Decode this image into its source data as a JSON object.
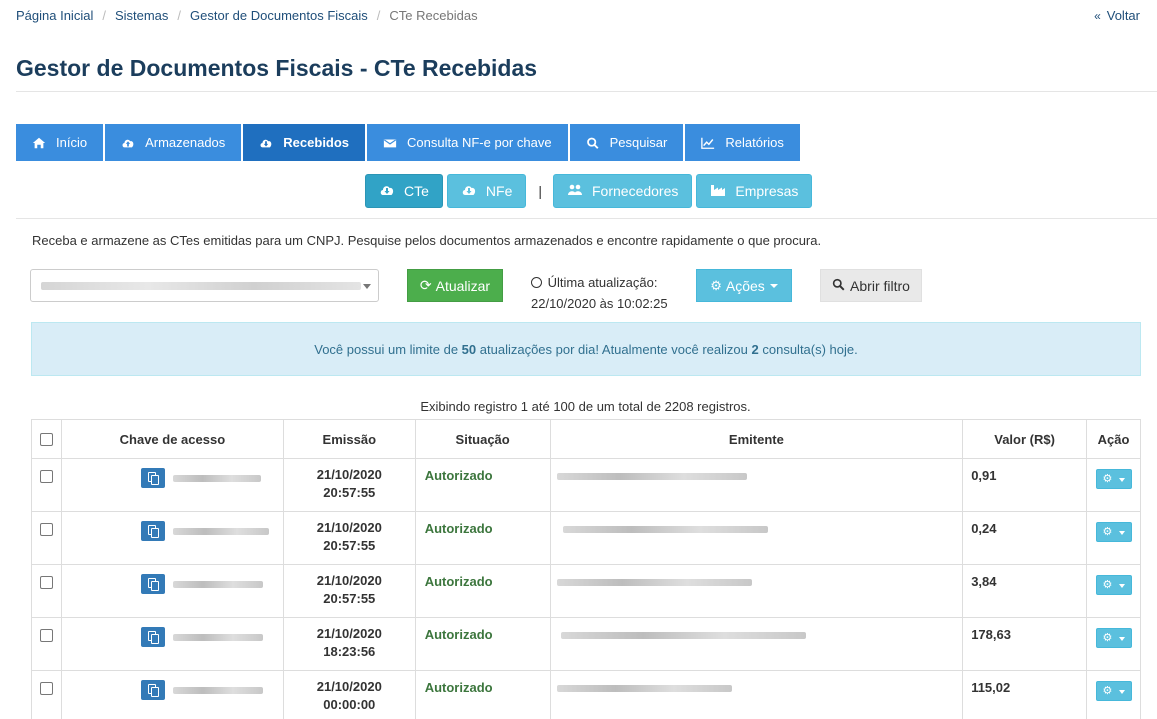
{
  "breadcrumb": {
    "items": [
      "Página Inicial",
      "Sistemas",
      "Gestor de Documentos Fiscais"
    ],
    "current": "CTe Recebidas",
    "separator": "/"
  },
  "back": {
    "label": "Voltar",
    "icon": "double-chevron-left-icon"
  },
  "page_title": "Gestor de Documentos Fiscais - CTe Recebidas",
  "main_tabs": [
    {
      "label": "Início",
      "icon": "home-icon",
      "active": false
    },
    {
      "label": "Armazenados",
      "icon": "cloud-upload-icon",
      "active": false
    },
    {
      "label": "Recebidos",
      "icon": "cloud-download-icon",
      "active": true
    },
    {
      "label": "Consulta NF-e por chave",
      "icon": "envelope-icon",
      "active": false
    },
    {
      "label": "Pesquisar",
      "icon": "search-icon",
      "active": false
    },
    {
      "label": "Relatórios",
      "icon": "line-chart-icon",
      "active": false
    }
  ],
  "sub_tabs": [
    {
      "label": "CTe",
      "icon": "cloud-download-icon",
      "active": true
    },
    {
      "label": "NFe",
      "icon": "cloud-download-icon",
      "active": false
    }
  ],
  "sub_separator": "|",
  "sub_tabs_right": [
    {
      "label": "Fornecedores",
      "icon": "users-icon"
    },
    {
      "label": "Empresas",
      "icon": "industry-icon"
    }
  ],
  "intro": "Receba e armazene as CTes emitidas para um CNPJ. Pesquise pelos documentos armazenados e encontre rapidamente o que procura.",
  "toolbar": {
    "atualizar_label": "Atualizar",
    "last_update_label": "Última atualização:",
    "last_update_value": "22/10/2020 às 10:02:25",
    "acoes_label": "Ações",
    "filtro_label": "Abrir filtro"
  },
  "alert": {
    "prefix": "Você possui um limite de ",
    "limit": "50",
    "middle": " atualizações por dia! Atualmente você realizou ",
    "count": "2",
    "suffix": " consulta(s) hoje."
  },
  "records_info": "Exibindo registro 1 até 100 de um total de 2208 registros.",
  "table": {
    "headers": {
      "chave": "Chave de acesso",
      "emissao": "Emissão",
      "situacao": "Situação",
      "emitente": "Emitente",
      "valor": "Valor (R$)",
      "acao": "Ação"
    },
    "rows": [
      {
        "data": "21/10/2020",
        "hora": "20:57:55",
        "situacao": "Autorizado",
        "valor": "0,91"
      },
      {
        "data": "21/10/2020",
        "hora": "20:57:55",
        "situacao": "Autorizado",
        "valor": "0,24"
      },
      {
        "data": "21/10/2020",
        "hora": "20:57:55",
        "situacao": "Autorizado",
        "valor": "3,84"
      },
      {
        "data": "21/10/2020",
        "hora": "18:23:56",
        "situacao": "Autorizado",
        "valor": "178,63"
      },
      {
        "data": "21/10/2020",
        "hora": "00:00:00",
        "situacao": "Autorizado",
        "valor": "115,02"
      }
    ]
  },
  "colors": {
    "tab": "#3a8dde",
    "tab_active": "#1f6fbf",
    "info": "#5bc0de",
    "success": "#4cae4c",
    "alert_bg": "#d9edf7",
    "status_ok": "#3c763d"
  }
}
